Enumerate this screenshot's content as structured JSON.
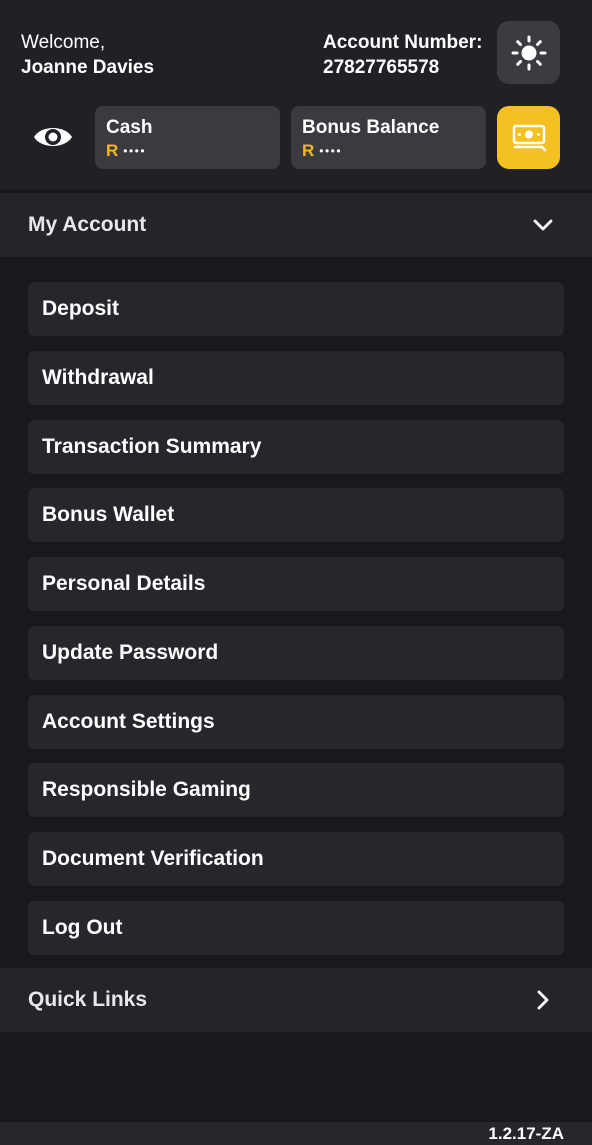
{
  "header": {
    "welcome_label": "Welcome,",
    "user_name": "Joanne Davies",
    "account_number_label": "Account Number:",
    "account_number": "27827765578",
    "theme_icon": "sun-icon",
    "visibility_icon": "eye-icon",
    "wallet_icon": "cash-icon",
    "accent_color": "#f5c021"
  },
  "balances": {
    "cash": {
      "label": "Cash",
      "currency": "R",
      "masked_value": "••••"
    },
    "bonus": {
      "label": "Bonus Balance",
      "currency": "R",
      "masked_value": "••••"
    }
  },
  "my_account": {
    "title": "My Account",
    "toggle_icon": "chevron-down-icon",
    "items": [
      {
        "label": "Deposit"
      },
      {
        "label": "Withdrawal"
      },
      {
        "label": "Transaction Summary"
      },
      {
        "label": "Bonus Wallet"
      },
      {
        "label": "Personal Details"
      },
      {
        "label": "Update Password"
      },
      {
        "label": "Account Settings"
      },
      {
        "label": "Responsible Gaming"
      },
      {
        "label": "Document Verification"
      },
      {
        "label": "Log Out"
      }
    ]
  },
  "quick_links": {
    "title": "Quick Links",
    "toggle_icon": "chevron-right-icon"
  },
  "footer": {
    "version": "1.2.17-ZA"
  }
}
